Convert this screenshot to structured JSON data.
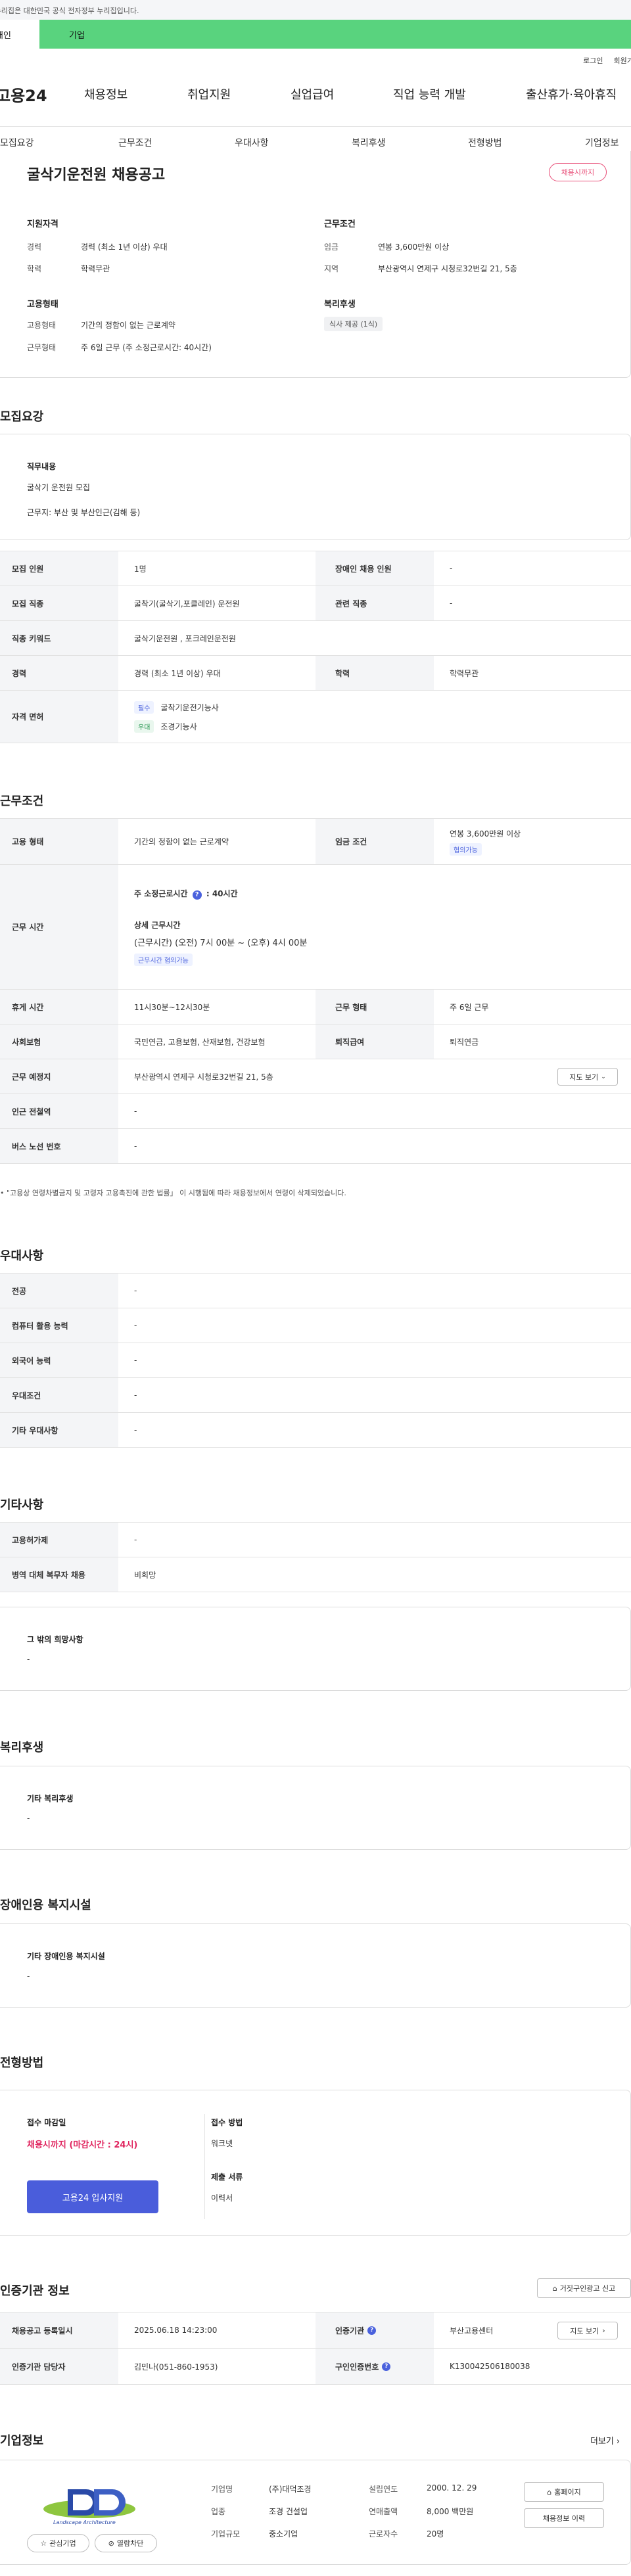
{
  "topbar": {
    "notice": "이 누리집은 대한민국 공식 전자정부 누리집입니다."
  },
  "tabs": {
    "personal": "개인",
    "company": "기업"
  },
  "util": {
    "login": "로그인",
    "join": "회원가입"
  },
  "nav": {
    "logo": "고용24",
    "items": [
      "채용정보",
      "취업지원",
      "실업급여",
      "직업 능력 개발",
      "출산휴가·육아휴직"
    ]
  },
  "subnav": [
    "모집요강",
    "근무조건",
    "우대사항",
    "복리후생",
    "전형방법",
    "기업정보"
  ],
  "summary": {
    "title": "굴삭기운전원 채용공고",
    "badge": "채용시까지",
    "qual_head": "지원자격",
    "qual": [
      [
        "경력",
        "경력 (최소 1년 이상) 우대"
      ],
      [
        "학력",
        "학력무관"
      ]
    ],
    "work_head": "근무조건",
    "work": [
      [
        "임금",
        "연봉 3,600만원 이상"
      ],
      [
        "지역",
        "부산광역시 연제구 시청로32번길 21, 5층"
      ]
    ],
    "emp_head": "고용형태",
    "emp": [
      [
        "고용형태",
        "기간의 정함이 없는 근로계약"
      ],
      [
        "근무형태",
        "주 6일 근무 (주 소정근로시간: 40시간)"
      ]
    ],
    "welfare_head": "복리후생",
    "welfare_chip": "식사 제공 (1식)"
  },
  "recruit": {
    "title": "모집요강",
    "duty_head": "직무내용",
    "duty_lines": [
      "굴삭기 운전원 모집",
      "근무지: 부산 및 부산인근(김해 등)"
    ],
    "rows": {
      "headcount_l": "모집 인원",
      "headcount_v": "1명",
      "disabled_l": "장애인 채용 인원",
      "disabled_v": "-",
      "job_l": "모집 직종",
      "job_v": "굴착기(굴삭기,포클레인) 운전원",
      "rel_l": "관련 직종",
      "rel_v": "-",
      "kw_l": "직종 키워드",
      "kw_v": "굴삭기운전원 , 포크레인운전원",
      "career_l": "경력",
      "career_v": "경력 (최소 1년 이상) 우대",
      "edu_l": "학력",
      "edu_v": "학력무관",
      "license_l": "자격 면허",
      "licenses": [
        {
          "chip": "필수",
          "name": "굴착기운전기능사"
        },
        {
          "chip": "우대",
          "name": "조경기능사"
        }
      ]
    }
  },
  "conditions": {
    "title": "근무조건",
    "type_l": "고용 형태",
    "type_v": "기간의 정함이 없는 근로계약",
    "wage_l": "임금 조건",
    "wage_v": "연봉 3,600만원 이상",
    "wage_chip": "협의가능",
    "hours_l": "근무 시간",
    "hours_main": "주 소정근로시간",
    "hours_main_v": ": 40시간",
    "hours_detail_head": "상세 근무시간",
    "hours_detail": "(근무시간) (오전) 7시 00분 ~ (오후) 4시 00분",
    "hours_chip": "근무시간 협의가능",
    "rest_l": "휴게 시간",
    "rest_v": "11시30분~12시30분",
    "form_l": "근무 형태",
    "form_v": "주 6일 근무",
    "ins_l": "사회보험",
    "ins_v": "국민연금, 고용보험, 산재보험, 건강보험",
    "retire_l": "퇴직급여",
    "retire_v": "퇴직연금",
    "place_l": "근무 예정지",
    "place_v": "부산광역시 연제구 시청로32번길 21, 5층",
    "map_btn": "지도 보기",
    "ind_l": "인근 전철역",
    "ind_v": "-",
    "bus_l": "버스 노선 번호",
    "bus_v": "-",
    "note": "\"고용상 연령차별금지 및 고령자 고용촉진에 관한 법률」 이 시행됨에 따라 채용정보에서 연령이 삭제되었습니다."
  },
  "prefs": {
    "title": "우대사항",
    "rows": [
      [
        "전공",
        "-"
      ],
      [
        "컴퓨터 활용 능력",
        "-"
      ],
      [
        "외국어 능력",
        "-"
      ],
      [
        "우대조건",
        "-"
      ],
      [
        "기타 우대사항",
        "-"
      ]
    ]
  },
  "others": {
    "title": "기타사항",
    "rows": [
      [
        "고용허가제",
        "-"
      ],
      [
        "병역 대체 복무자 채용",
        "비희망"
      ]
    ],
    "wish_head": "그 밖의 희망사항",
    "wish_v": "-"
  },
  "welfare": {
    "title": "복리후생",
    "head": "기타 복리후생",
    "v": "-"
  },
  "facility": {
    "title": "장애인용 복지시설",
    "head": "기타 장애인용 복지시설",
    "v": "-"
  },
  "process": {
    "title": "전형방법",
    "deadline_head": "접수 마감일",
    "deadline_v": "채용시까지 (마감시간 : 24시)",
    "apply_btn": "고용24 입사지원",
    "method_head": "접수 방법",
    "method_v": "워크넷",
    "docs_head": "제출 서류",
    "docs_v": "이력서"
  },
  "agency": {
    "title": "인증기관 정보",
    "report_btn": "거짓구인광고 신고",
    "reg_l": "채용공고 등록일시",
    "reg_v": "2025.06.18 14:23:00",
    "org_l": "인증기관",
    "org_v": "부산고용센터",
    "map_btn": "지도 보기",
    "mgr_l": "인증기관 담당자",
    "mgr_v": "김민나(051-860-1953)",
    "num_l": "구인인증번호",
    "num_v": "K130042506180038"
  },
  "company": {
    "title": "기업정보",
    "more": "더보기",
    "logo_text": "Landscape Architecture",
    "fields": [
      [
        "기업명",
        "(주)대덕조경"
      ],
      [
        "업종",
        "조경 건설업"
      ],
      [
        "기업규모",
        "중소기업"
      ],
      [
        "설립연도",
        "2000. 12. 29"
      ],
      [
        "연매출액",
        "8,000 백만원"
      ],
      [
        "근로자수",
        "20명"
      ]
    ],
    "home_btn": "홈페이지",
    "history_btn": "채용정보 이력",
    "fav_btn": "관심기업",
    "block_btn": "열람차단"
  }
}
